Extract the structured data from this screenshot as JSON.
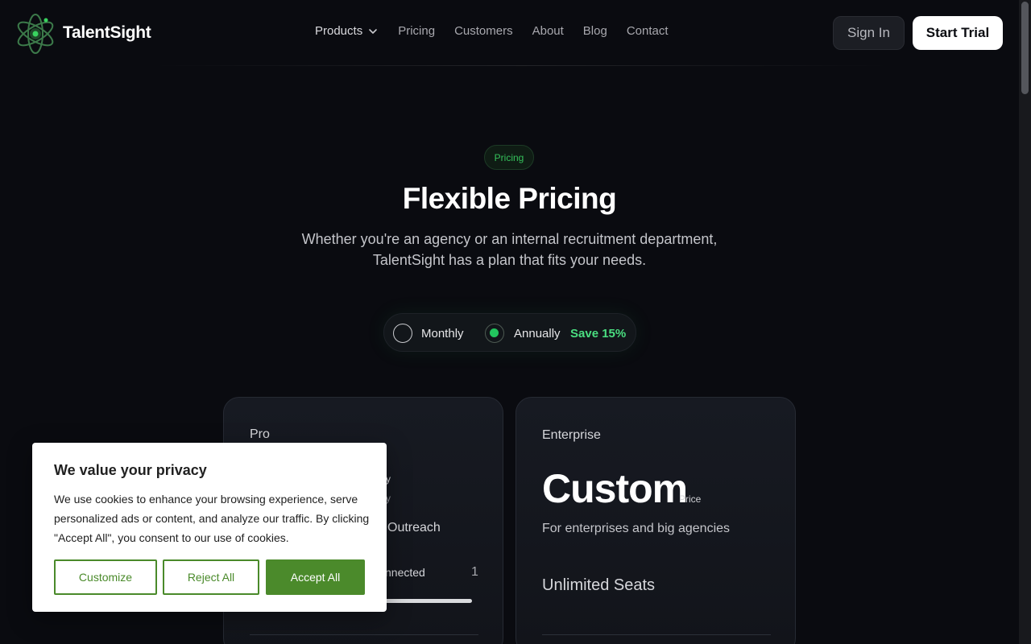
{
  "brand": {
    "name": "TalentSight"
  },
  "nav": {
    "items": [
      {
        "label": "Products",
        "has_dropdown": true
      },
      {
        "label": "Pricing"
      },
      {
        "label": "Customers"
      },
      {
        "label": "About"
      },
      {
        "label": "Blog"
      },
      {
        "label": "Contact"
      }
    ],
    "sign_in": "Sign In",
    "start_trial": "Start Trial"
  },
  "hero": {
    "badge": "Pricing",
    "title": "Flexible Pricing",
    "subtitle_line1": "Whether you're an agency or an internal recruitment department,",
    "subtitle_line2": "TalentSight has a plan that fits your needs."
  },
  "billing_toggle": {
    "monthly": "Monthly",
    "annually": "Annually",
    "save": "Save 15%",
    "selected": "annually"
  },
  "plans": {
    "pro": {
      "name": "Pro",
      "frag_y": "y",
      "frag_y2": "y",
      "outreach": "Outreach",
      "connected": "nnected",
      "count": "1"
    },
    "enterprise": {
      "name": "Enterprise",
      "price": "Custom",
      "price_note": "Price",
      "description": "For enterprises and big agencies",
      "seats": "Unlimited Seats"
    }
  },
  "cookie": {
    "title": "We value your privacy",
    "text": "We use cookies to enhance your browsing experience, serve personalized ads or content, and analyze our traffic. By clicking \"Accept All\", you consent to our use of cookies.",
    "customize": "Customize",
    "reject": "Reject All",
    "accept": "Accept All"
  },
  "colors": {
    "background": "#0a0b10",
    "accent_green": "#22c55e",
    "cookie_green": "#4b8a2b"
  }
}
